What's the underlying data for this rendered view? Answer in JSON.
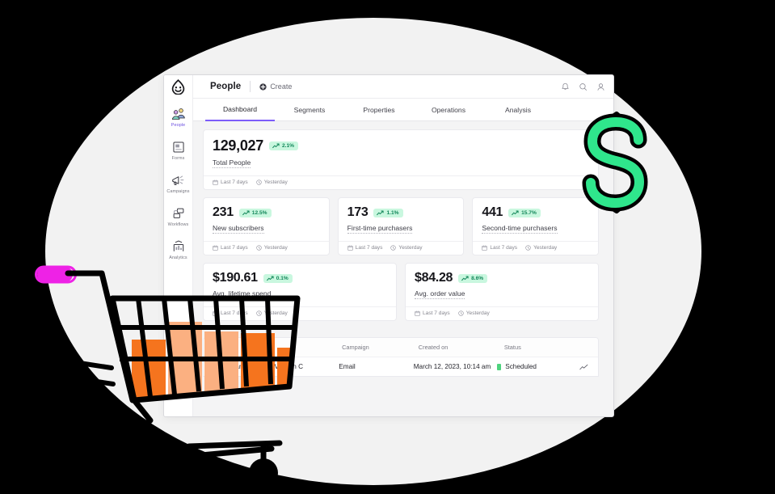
{
  "app": {
    "brand_title": "People",
    "create_label": "Create",
    "logo_icon": "egg-face-logo",
    "topbar_icons": [
      "bell-icon",
      "search-icon",
      "user-icon"
    ]
  },
  "sidebar": {
    "items": [
      {
        "label": "People",
        "icon": "people-icon",
        "active": true
      },
      {
        "label": "Forms",
        "icon": "form-icon",
        "active": false
      },
      {
        "label": "Campaigns",
        "icon": "megaphone-icon",
        "active": false
      },
      {
        "label": "Workflows",
        "icon": "workflow-icon",
        "active": false
      },
      {
        "label": "Analytics",
        "icon": "bar-chart-icon",
        "active": false
      }
    ]
  },
  "tabs": [
    {
      "label": "Dashboard",
      "active": true
    },
    {
      "label": "Segments",
      "active": false
    },
    {
      "label": "Properties",
      "active": false
    },
    {
      "label": "Operations",
      "active": false
    },
    {
      "label": "Analysis",
      "active": false
    }
  ],
  "date_chips": {
    "range": "Last 7 days",
    "compare": "Yesterday"
  },
  "metrics": {
    "hero": {
      "value": "129,027",
      "trend": "2.1%",
      "label": "Total People"
    },
    "row1": [
      {
        "value": "231",
        "trend": "12.5%",
        "label": "New subscribers"
      },
      {
        "value": "173",
        "trend": "1.1%",
        "label": "First-time purchasers"
      },
      {
        "value": "441",
        "trend": "15.7%",
        "label": "Second-time purchasers"
      }
    ],
    "row2": [
      {
        "value": "$190.61",
        "trend": "0.1%",
        "label": "Avg. lifetime spend"
      },
      {
        "value": "$84.28",
        "trend": "8.6%",
        "label": "Avg. order value"
      }
    ]
  },
  "table": {
    "headers": {
      "name": "",
      "campaign": "Campaign",
      "created": "Created on",
      "status": "Status"
    },
    "rows": [
      {
        "name": "Cart Abandonment - Version C",
        "campaign": "Email",
        "created": "March 12, 2023, 10:14 am",
        "status": "Scheduled"
      }
    ]
  },
  "colors": {
    "accent_purple": "#7C5CFA",
    "trend_green_bg": "#C9F7DF",
    "trend_green_text": "#12875A",
    "dollar_green": "#2FE68C",
    "cart_orange_dark": "#F5741E",
    "cart_orange_light": "#FBB081",
    "cart_handle_magenta": "#EE22E6",
    "backdrop": "#F2F2F2",
    "page_bg": "#000000"
  },
  "decor": {
    "dollar_sign": "$",
    "cart_icon": "shopping-cart-illustration"
  }
}
